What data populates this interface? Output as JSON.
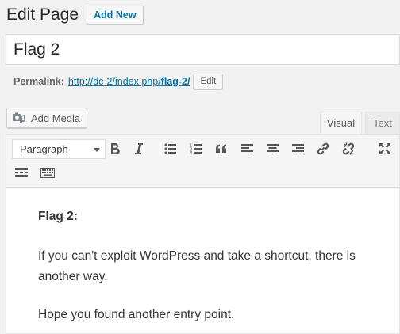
{
  "header": {
    "title": "Edit Page",
    "add_new_label": "Add New"
  },
  "post": {
    "title": "Flag 2"
  },
  "permalink": {
    "label": "Permalink:",
    "url_base": "http://dc-2/index.php/",
    "slug": "flag-2/",
    "edit_label": "Edit"
  },
  "media": {
    "add_media_label": "Add Media",
    "icon": "camera-music-icon"
  },
  "editor_tabs": {
    "visual": "Visual",
    "text": "Text",
    "active": "Visual"
  },
  "toolbar": {
    "format_selected": "Paragraph",
    "buttons_row1": [
      "bold-icon",
      "italic-icon",
      "bulleted-list-icon",
      "numbered-list-icon",
      "blockquote-icon",
      "align-left-icon",
      "align-center-icon",
      "align-right-icon",
      "link-icon",
      "unlink-icon",
      "fullscreen-icon"
    ],
    "buttons_row2": [
      "read-more-icon",
      "toolbar-toggle-icon"
    ]
  },
  "content": {
    "heading": "Flag 2:",
    "paragraph1": "If you can't exploit WordPress and take a shortcut, there is another way.",
    "paragraph2": "Hope you found another entry point."
  },
  "colors": {
    "link": "#0073aa",
    "background": "#f1f1f1",
    "text": "#23282d"
  }
}
